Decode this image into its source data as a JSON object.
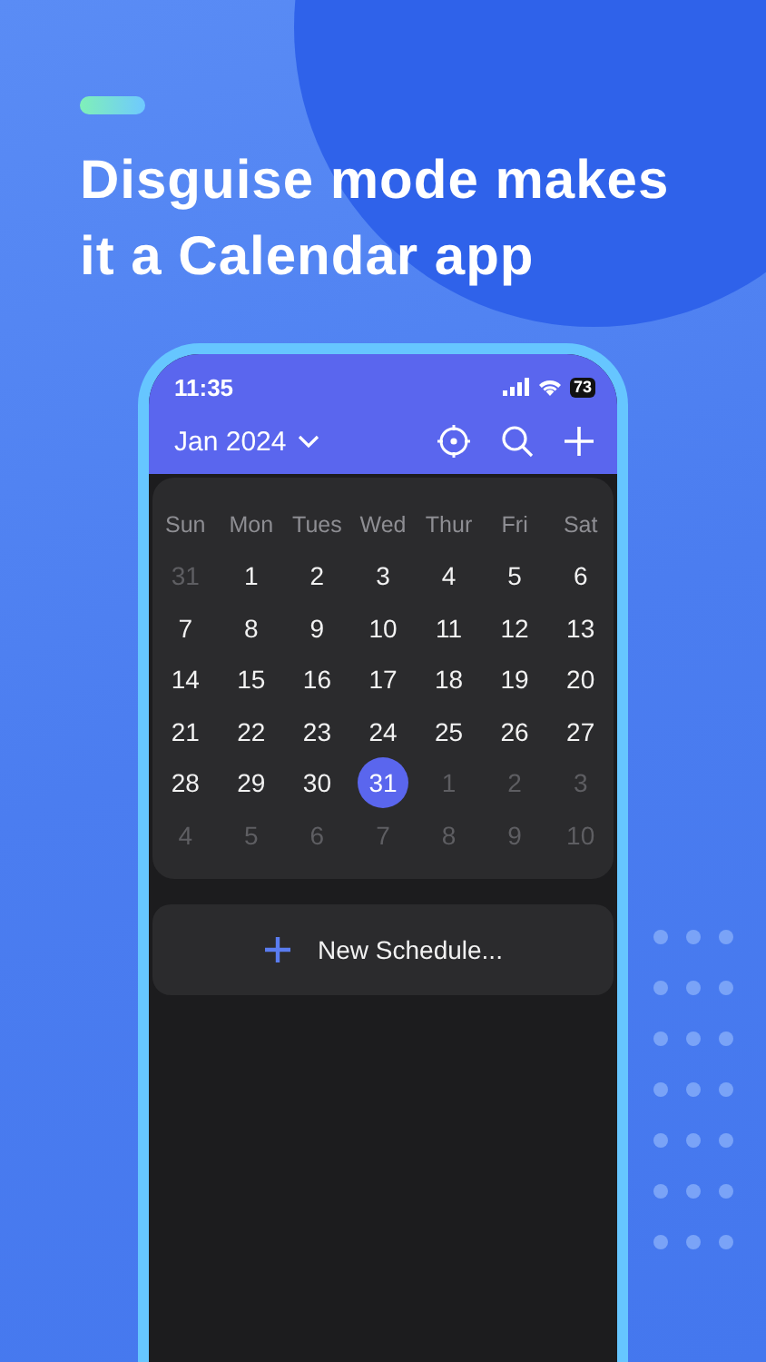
{
  "headline": [
    "Disguise mode makes",
    "it a Calendar app"
  ],
  "status_bar": {
    "time": "11:35",
    "battery": "73"
  },
  "header": {
    "month": "Jan 2024"
  },
  "calendar": {
    "weekdays": [
      "Sun",
      "Mon",
      "Tues",
      "Wed",
      "Thur",
      "Fri",
      "Sat"
    ],
    "weeks": [
      [
        {
          "day": "31",
          "outside_month": true,
          "selected": false
        },
        {
          "day": "1",
          "outside_month": false,
          "selected": false
        },
        {
          "day": "2",
          "outside_month": false,
          "selected": false
        },
        {
          "day": "3",
          "outside_month": false,
          "selected": false
        },
        {
          "day": "4",
          "outside_month": false,
          "selected": false
        },
        {
          "day": "5",
          "outside_month": false,
          "selected": false
        },
        {
          "day": "6",
          "outside_month": false,
          "selected": false
        }
      ],
      [
        {
          "day": "7",
          "outside_month": false,
          "selected": false
        },
        {
          "day": "8",
          "outside_month": false,
          "selected": false
        },
        {
          "day": "9",
          "outside_month": false,
          "selected": false
        },
        {
          "day": "10",
          "outside_month": false,
          "selected": false
        },
        {
          "day": "11",
          "outside_month": false,
          "selected": false
        },
        {
          "day": "12",
          "outside_month": false,
          "selected": false
        },
        {
          "day": "13",
          "outside_month": false,
          "selected": false
        }
      ],
      [
        {
          "day": "14",
          "outside_month": false,
          "selected": false
        },
        {
          "day": "15",
          "outside_month": false,
          "selected": false
        },
        {
          "day": "16",
          "outside_month": false,
          "selected": false
        },
        {
          "day": "17",
          "outside_month": false,
          "selected": false
        },
        {
          "day": "18",
          "outside_month": false,
          "selected": false
        },
        {
          "day": "19",
          "outside_month": false,
          "selected": false
        },
        {
          "day": "20",
          "outside_month": false,
          "selected": false
        }
      ],
      [
        {
          "day": "21",
          "outside_month": false,
          "selected": false
        },
        {
          "day": "22",
          "outside_month": false,
          "selected": false
        },
        {
          "day": "23",
          "outside_month": false,
          "selected": false
        },
        {
          "day": "24",
          "outside_month": false,
          "selected": false
        },
        {
          "day": "25",
          "outside_month": false,
          "selected": false
        },
        {
          "day": "26",
          "outside_month": false,
          "selected": false
        },
        {
          "day": "27",
          "outside_month": false,
          "selected": false
        }
      ],
      [
        {
          "day": "28",
          "outside_month": false,
          "selected": false
        },
        {
          "day": "29",
          "outside_month": false,
          "selected": false
        },
        {
          "day": "30",
          "outside_month": false,
          "selected": false
        },
        {
          "day": "31",
          "outside_month": false,
          "selected": true
        },
        {
          "day": "1",
          "outside_month": true,
          "selected": false
        },
        {
          "day": "2",
          "outside_month": true,
          "selected": false
        },
        {
          "day": "3",
          "outside_month": true,
          "selected": false
        }
      ],
      [
        {
          "day": "4",
          "outside_month": true,
          "selected": false
        },
        {
          "day": "5",
          "outside_month": true,
          "selected": false
        },
        {
          "day": "6",
          "outside_month": true,
          "selected": false
        },
        {
          "day": "7",
          "outside_month": true,
          "selected": false
        },
        {
          "day": "8",
          "outside_month": true,
          "selected": false
        },
        {
          "day": "9",
          "outside_month": true,
          "selected": false
        },
        {
          "day": "10",
          "outside_month": true,
          "selected": false
        }
      ]
    ]
  },
  "new_schedule": {
    "label": "New Schedule..."
  }
}
